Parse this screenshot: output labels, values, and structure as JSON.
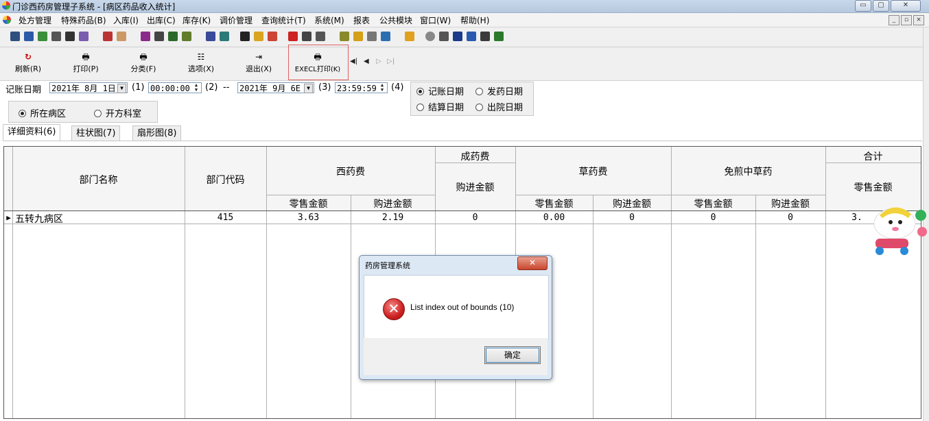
{
  "window": {
    "title": "门诊西药房管理子系统 - [病区药品收入统计]",
    "controls": [
      "▭",
      "▢",
      "✕"
    ]
  },
  "menu": {
    "items": [
      "处方管理",
      "特殊药品(B)",
      "入库(I)",
      "出库(C)",
      "库存(K)",
      "调价管理",
      "查询统计(T)",
      "系统(M)",
      "报表",
      "公共模块",
      "窗口(W)",
      "帮助(H)"
    ],
    "mdi_controls": [
      "_",
      "▫",
      "×"
    ]
  },
  "toolbar": {
    "buttons": [
      {
        "label": "刷新(R)",
        "icon": "refresh-icon"
      },
      {
        "label": "打印(P)",
        "icon": "printer-icon"
      },
      {
        "label": "分类(F)",
        "icon": "printer-icon"
      },
      {
        "label": "选项(X)",
        "icon": "options-icon"
      },
      {
        "label": "退出(X)",
        "icon": "exit-icon"
      },
      {
        "label": "EXECL打印(K)",
        "icon": "printer-icon"
      }
    ],
    "nav": [
      "◀|",
      "◀",
      "▷",
      "▷|"
    ]
  },
  "filters": {
    "date_label": "记账日期",
    "start_date": "2021年 8月 1日",
    "marker1": "(1)",
    "start_time": "00:00:00",
    "marker2": "(2)",
    "dash": "--",
    "end_date": "2021年 9月 6E",
    "marker3": "(3)",
    "end_time": "23:59:59",
    "marker4": "(4)",
    "date_type_options": [
      {
        "label": "记账日期",
        "selected": true
      },
      {
        "label": "发药日期",
        "selected": false
      },
      {
        "label": "结算日期",
        "selected": false
      },
      {
        "label": "出院日期",
        "selected": false
      }
    ],
    "dept_options": [
      {
        "label": "所在病区",
        "selected": true
      },
      {
        "label": "开方科室",
        "selected": false
      }
    ]
  },
  "tabs": [
    {
      "label": "详细资料(6)",
      "active": true
    },
    {
      "label": "柱状图(7)",
      "active": false
    },
    {
      "label": "扇形图(8)",
      "active": false
    }
  ],
  "table": {
    "headers": {
      "dept_name": "部门名称",
      "dept_code": "部门代码",
      "western": "西药费",
      "patent": "成药费",
      "herbal": "草药费",
      "decoction_free": "免煎中草药",
      "total": "合计",
      "retail": "零售金额",
      "purchase": "购进金额"
    },
    "rows": [
      {
        "indicator": "▶",
        "dept_name": "五转九病区",
        "dept_code": "415",
        "western_retail": "3.63",
        "western_purchase": "2.19",
        "patent_purchase": "0",
        "herbal_retail": "0.00",
        "herbal_purchase": "0",
        "decoction_retail": "0",
        "decoction_purchase": "0",
        "total_retail": "3."
      }
    ]
  },
  "dialog": {
    "title": "药房管理系统",
    "close": "✕",
    "message": "List index out of bounds (10)",
    "ok": "确定",
    "icon": "error-icon"
  }
}
